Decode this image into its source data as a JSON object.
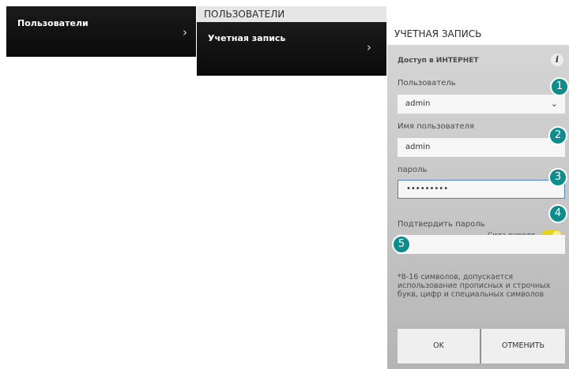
{
  "nav": {
    "users_label": "Пользователи",
    "section_header": "ПОЛЬЗОВАТЕЛИ",
    "account_label": "Учетная запись"
  },
  "panel": {
    "title": "УЧЕТНАЯ ЗАПИСЬ",
    "section_title": "Доступ в ИНТЕРНЕТ",
    "info_glyph": "i",
    "user_label": "Пользователь",
    "user_select_value": "admin",
    "username_label": "Имя пользователя",
    "username_value": "admin",
    "password_label": "пароль",
    "password_value": "•••••••••",
    "strength_label": "Сила пароля",
    "confirm_label": "Подтвердить пароль",
    "confirm_value": "",
    "hint": "*8-16 символов, допускается использование прописных и строчных букв, цифр и специальных символов",
    "ok_label": "OK",
    "cancel_label": "ОТМЕНИТЬ"
  },
  "badges": [
    "1",
    "2",
    "3",
    "4",
    "5"
  ],
  "icons": {
    "chevron": "chevron-right-icon",
    "dropdown": "chevron-down-icon",
    "info": "info-icon"
  },
  "colors": {
    "badge": "#0f8d8d",
    "toggle": "#e5d21a",
    "focus_border": "#4c84c2"
  }
}
